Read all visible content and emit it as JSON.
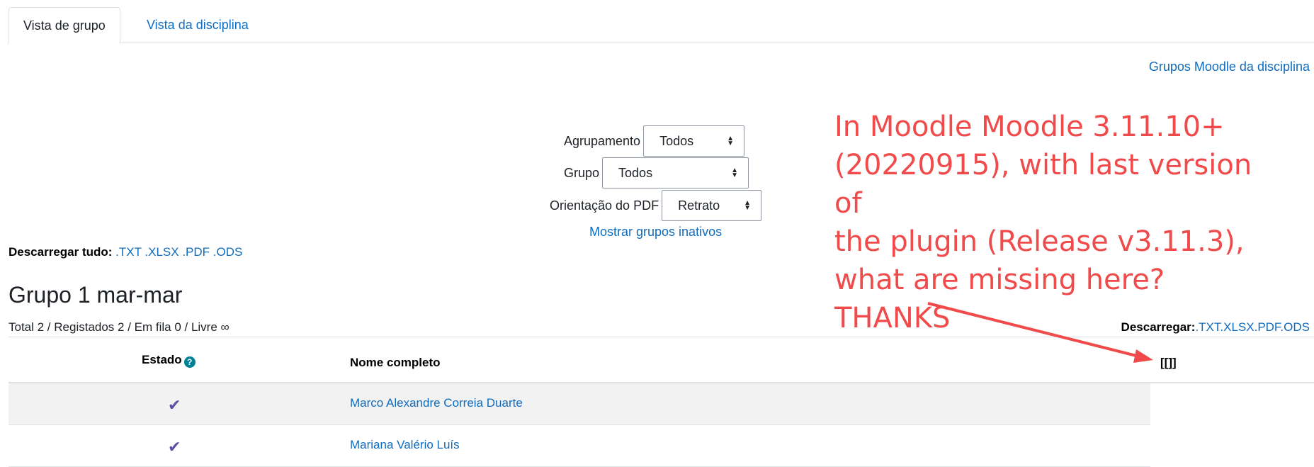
{
  "tabs": [
    {
      "label": "Vista de grupo",
      "active": true
    },
    {
      "label": "Vista da disciplina",
      "active": false
    }
  ],
  "top_link": "Grupos Moodle da disciplina",
  "filters": {
    "grouping_label": "Agrupamento",
    "grouping_value": "Todos",
    "group_label": "Grupo",
    "group_value": "Todos",
    "pdf_label": "Orientação do PDF",
    "pdf_value": "Retrato",
    "inactive_link": "Mostrar grupos inativos"
  },
  "download_all": {
    "label": "Descarregar tudo:",
    "formats": ".TXT .XLSX .PDF .ODS"
  },
  "group": {
    "title": "Grupo 1 mar-mar",
    "stats": "Total 2 / Registados 2 / Em fila 0 / Livre ∞",
    "download_label": "Descarregar:",
    "download_formats": ".TXT.XLSX.PDF.ODS"
  },
  "table": {
    "headers": {
      "status": "Estado",
      "name": "Nome completo",
      "extra": "[[]]"
    },
    "help_icon": "question-circle-icon",
    "rows": [
      {
        "status": "✔",
        "name": "Marco Alexandre Correia Duarte"
      },
      {
        "status": "✔",
        "name": "Mariana Valério Luís"
      }
    ]
  },
  "annotation": {
    "lines": [
      "In Moodle Moodle 3.11.10+",
      "(20220915), with last version of",
      "the plugin (Release v3.11.3),",
      "what are missing here?",
      "THANKS"
    ],
    "color": "#f04a4a"
  },
  "colors": {
    "link": "#0f6cbf",
    "check": "#5b4fa0",
    "help": "#008196"
  }
}
